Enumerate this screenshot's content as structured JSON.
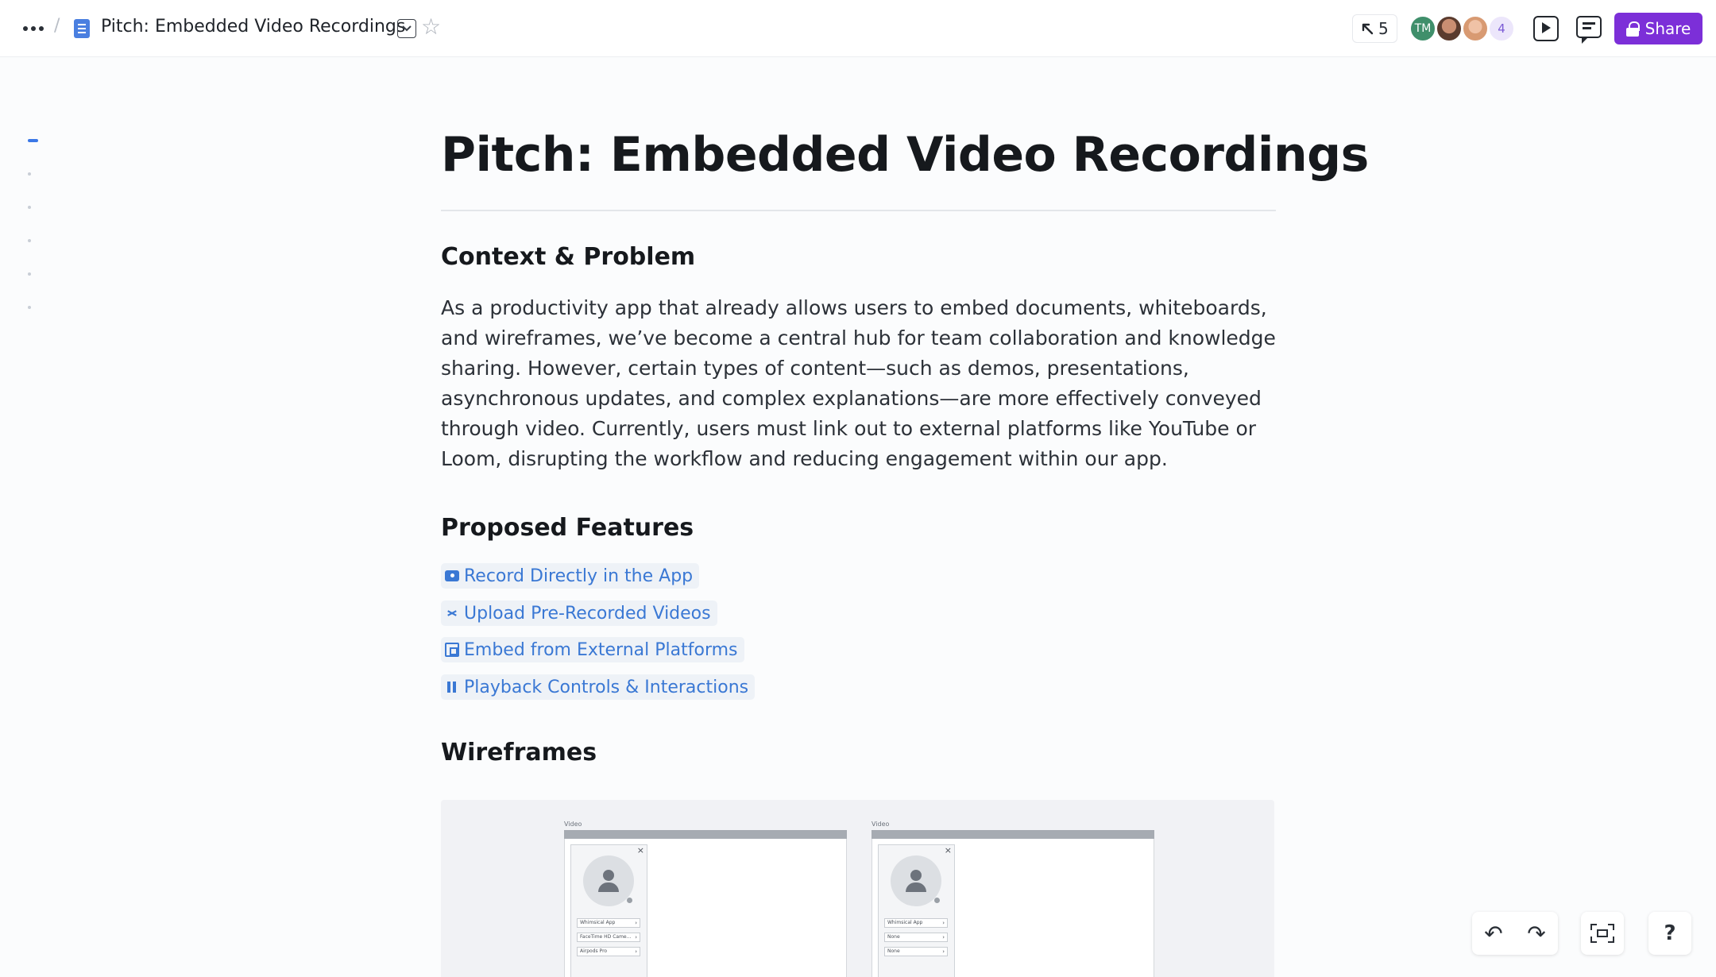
{
  "topbar": {
    "breadcrumb_separator": "/",
    "doc_title": "Pitch: Embedded Video Recordings",
    "cursor_count": "5",
    "avatars": [
      {
        "initials": "TM",
        "color": "#3f8f6b"
      },
      {
        "initials": "",
        "color": "#5a3b2e"
      },
      {
        "initials": "",
        "color": "#d89a72"
      }
    ],
    "more_collaborators": "4",
    "share_label": "Share",
    "accent": "#7c2fd8"
  },
  "outline": {
    "items": [
      "Pitch: Embedded Video Recordings",
      "Context & Problem",
      "Proposed Features",
      "Wireframes",
      "",
      ""
    ],
    "active_index": 0
  },
  "document": {
    "title": "Pitch: Embedded Video Recordings",
    "sections": {
      "context": {
        "heading": "Context & Problem",
        "body": "As a productivity app that already allows users to embed documents, whiteboards, and wireframes, we’ve become a central hub for team collaboration and knowledge sharing. However, certain types of content—such as demos, presentations, asynchronous updates, and complex explanations—are more effectively conveyed through video. Currently, users must link out to external platforms like YouTube or Loom, disrupting the workflow and reducing engagement within our app."
      },
      "features": {
        "heading": "Proposed Features",
        "links": [
          {
            "label": "Record Directly in the App",
            "icon": "video-record-icon"
          },
          {
            "label": "Upload Pre-Recorded Videos",
            "icon": "share-upload-icon"
          },
          {
            "label": "Embed from External Platforms",
            "icon": "embed-icon"
          },
          {
            "label": "Playback Controls & Interactions",
            "icon": "pause-icon"
          }
        ],
        "link_color": "#3a78d4"
      },
      "wireframes": {
        "heading": "Wireframes",
        "frames": [
          {
            "label": "Video",
            "selects": [
              "Whimsical App",
              "FaceTime HD Came...",
              "Airpods Pro"
            ],
            "close": "×",
            "tools": "⁘ ⠿ ⋯"
          },
          {
            "label": "Video",
            "selects": [
              "Whimsical App",
              "None",
              "None"
            ],
            "close": "×",
            "tools": "⁘ ⠿ ⋯"
          }
        ]
      }
    }
  },
  "controls": {
    "undo": "↶",
    "redo": "↷",
    "help": "?"
  }
}
